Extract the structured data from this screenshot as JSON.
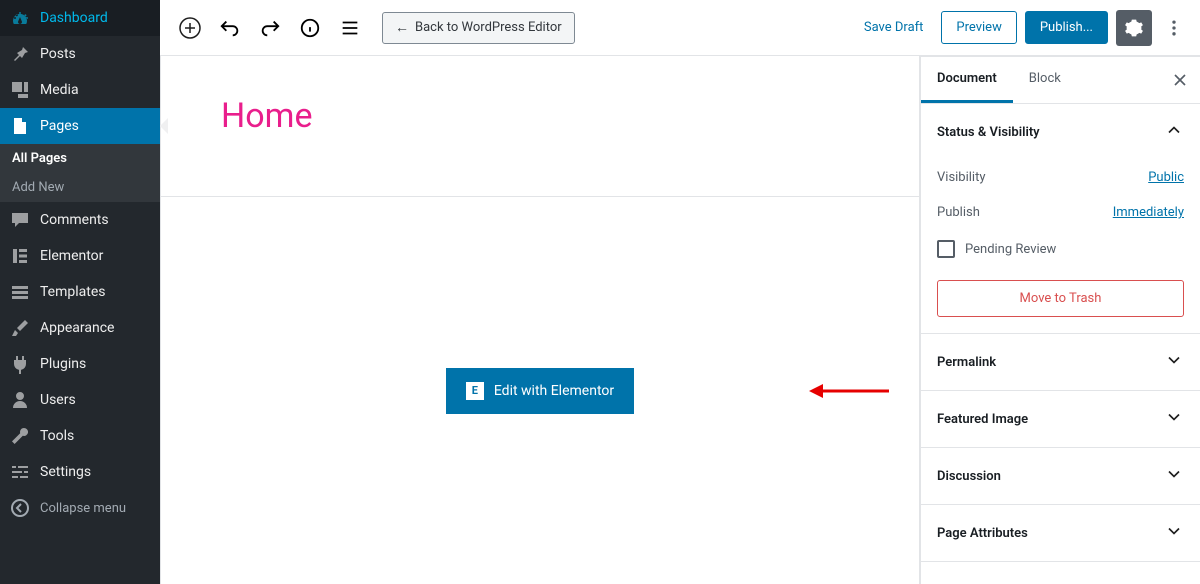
{
  "sidebar": {
    "items": [
      {
        "label": "Dashboard",
        "icon": "dashboard"
      },
      {
        "label": "Posts",
        "icon": "pin"
      },
      {
        "label": "Media",
        "icon": "media"
      },
      {
        "label": "Pages",
        "icon": "page",
        "active": true
      },
      {
        "label": "Comments",
        "icon": "comment"
      },
      {
        "label": "Elementor",
        "icon": "elementor"
      },
      {
        "label": "Templates",
        "icon": "templates"
      },
      {
        "label": "Appearance",
        "icon": "brush"
      },
      {
        "label": "Plugins",
        "icon": "plug"
      },
      {
        "label": "Users",
        "icon": "user"
      },
      {
        "label": "Tools",
        "icon": "wrench"
      },
      {
        "label": "Settings",
        "icon": "sliders"
      }
    ],
    "sub_items": [
      {
        "label": "All Pages",
        "current": true
      },
      {
        "label": "Add New"
      }
    ],
    "collapse_label": "Collapse menu"
  },
  "toolbar": {
    "back_label": "Back to WordPress Editor",
    "save_draft": "Save Draft",
    "preview": "Preview",
    "publish": "Publish..."
  },
  "editor": {
    "title": "Home",
    "elementor_btn": "Edit with Elementor"
  },
  "settings": {
    "tabs": {
      "document": "Document",
      "block": "Block"
    },
    "panels": {
      "status": {
        "title": "Status & Visibility",
        "visibility_label": "Visibility",
        "visibility_value": "Public",
        "publish_label": "Publish",
        "publish_value": "Immediately",
        "pending_review": "Pending Review",
        "trash": "Move to Trash"
      },
      "permalink": "Permalink",
      "featured_image": "Featured Image",
      "discussion": "Discussion",
      "page_attributes": "Page Attributes"
    }
  }
}
